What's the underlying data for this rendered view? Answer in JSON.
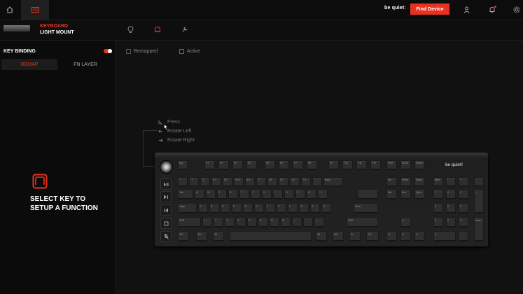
{
  "brand": {
    "text": "be quiet",
    "mark": "!"
  },
  "topbar": {
    "find_device": "Find Device"
  },
  "device": {
    "line1": "KEYBOARD",
    "line2": "LIGHT MOUNT"
  },
  "left": {
    "title": "KEY BINDING",
    "tabs": [
      "REMAP",
      "FN LAYER"
    ],
    "prompt": "SELECT KEY TO SETUP A FUNCTION"
  },
  "legend": {
    "remapped": "Remapped",
    "active": "Active"
  },
  "knob_menu": [
    "Press",
    "Rotate Left",
    "Rotate Right"
  ],
  "colors": {
    "accent": "#e8321f",
    "background": "#111111"
  },
  "keyboard": {
    "logo": "be quiet!",
    "rows": [
      [
        "Esc",
        "F1",
        "F2",
        "F3",
        "F4",
        "F5",
        "F6",
        "F7",
        "F8",
        "F9",
        "F10",
        "F11",
        "F12",
        "Print",
        "Scroll",
        "Pause"
      ],
      [
        "^",
        "! 1",
        "\" 2",
        "§ 3",
        "$ 4",
        "% 5",
        "& 6",
        "/ 7",
        "( 8",
        ") 9",
        "= 0",
        "? ß",
        "` ´",
        "Back",
        "Ins",
        "Home",
        "PgUp",
        "Num",
        "/",
        "*",
        "-"
      ],
      [
        "Tab",
        "Q",
        "W",
        "E",
        "R",
        "T",
        "Z",
        "U",
        "I",
        "O",
        "P",
        "Ü",
        "* +",
        "Del",
        "End",
        "PgDn",
        "7",
        "8",
        "9",
        "+"
      ],
      [
        "Caps",
        "A",
        "S",
        "D",
        "F",
        "G",
        "H",
        "J",
        "K",
        "L",
        "Ö",
        "Ä",
        "' #",
        "Enter",
        "4",
        "5",
        "6"
      ],
      [
        "Shift",
        "> <",
        "Y",
        "X",
        "C",
        "V",
        "B",
        "N",
        "M",
        "; ,",
        ": .",
        "_ -",
        "Shift",
        "▲",
        "1",
        "2",
        "3",
        "Enter"
      ],
      [
        "Ctrl",
        "Win",
        "Alt",
        "",
        "Alt",
        "Win",
        "Fn",
        "Ctrl",
        "◄",
        "▼",
        "►",
        "0",
        ","
      ]
    ]
  }
}
